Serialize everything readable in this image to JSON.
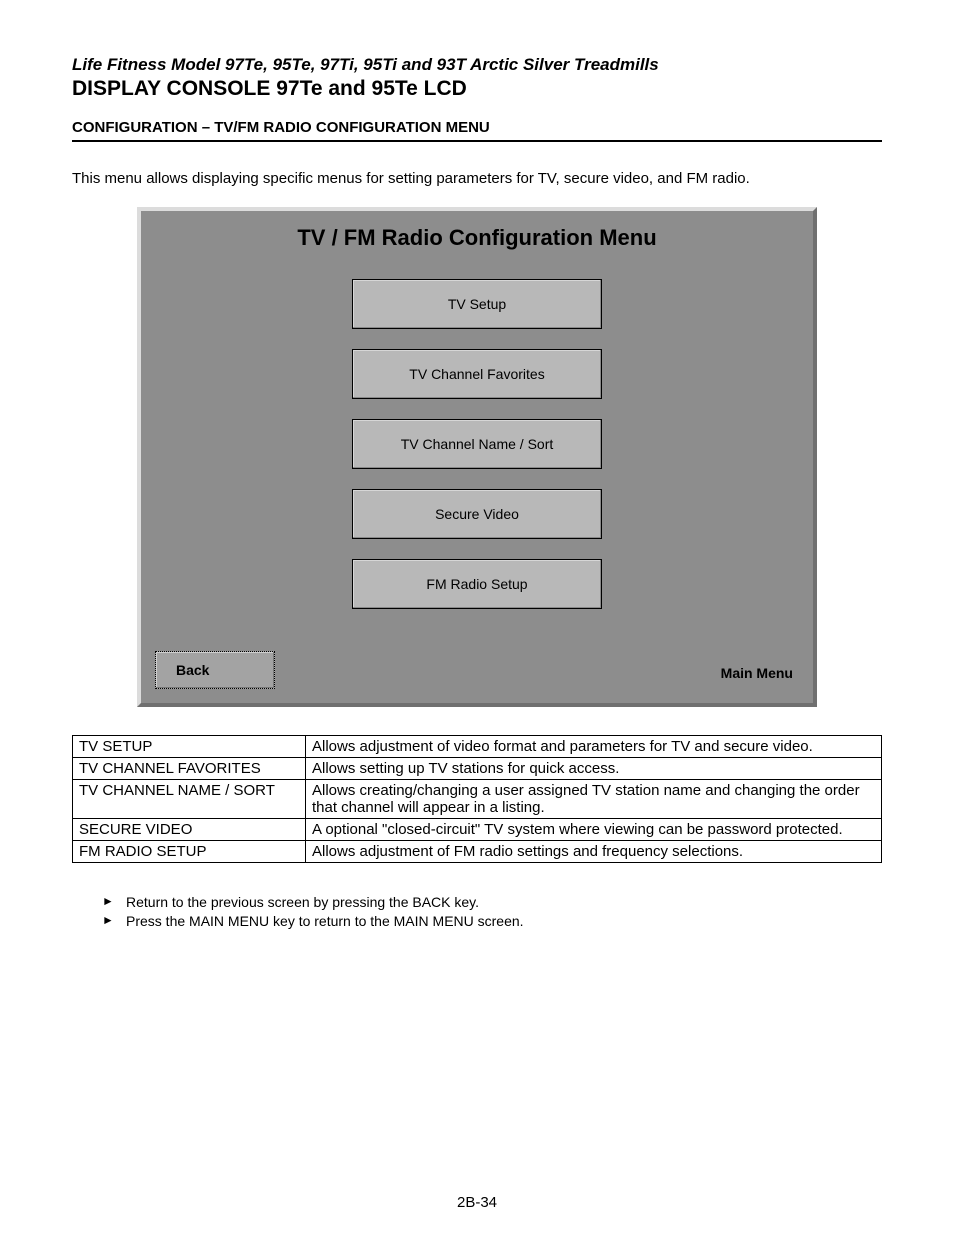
{
  "header": {
    "supertitle": "Life Fitness Model 97Te, 95Te, 97Ti, 95Ti and 93T Arctic Silver Treadmills",
    "title": "DISPLAY CONSOLE 97Te and 95Te LCD"
  },
  "section_heading": "CONFIGURATION – TV/FM RADIO CONFIGURATION MENU",
  "intro": "This menu allows displaying specific menus for setting parameters for TV, secure video, and FM radio.",
  "lcd": {
    "title": "TV / FM Radio Configuration Menu",
    "buttons": [
      "TV Setup",
      "TV Channel Favorites",
      "TV Channel Name / Sort",
      "Secure Video",
      "FM Radio Setup"
    ],
    "back": "Back",
    "main_menu": "Main Menu"
  },
  "table": [
    {
      "k": "TV SETUP",
      "v": "Allows adjustment of video format and parameters for TV and secure video."
    },
    {
      "k": "TV CHANNEL FAVORITES",
      "v": "Allows setting up TV stations for quick access."
    },
    {
      "k": "TV CHANNEL NAME / SORT",
      "v": "Allows creating/changing a user assigned TV station name and changing the order that channel will appear in a listing."
    },
    {
      "k": "SECURE VIDEO",
      "v": "A optional \"closed-circuit\" TV system where viewing can be password protected."
    },
    {
      "k": "FM RADIO SETUP",
      "v": "Allows adjustment of FM radio settings and frequency selections."
    }
  ],
  "bullets": [
    "Return to the previous screen by pressing the BACK key.",
    "Press the MAIN MENU key to return to the MAIN MENU screen."
  ],
  "page_number": "2B-34"
}
